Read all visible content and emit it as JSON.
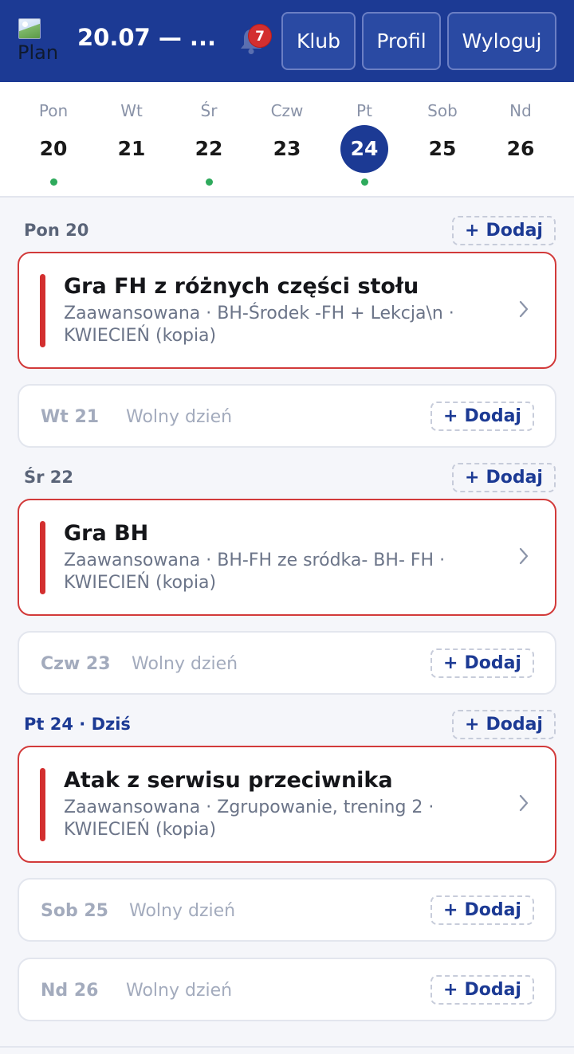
{
  "header": {
    "logo_alt": "Plan",
    "week_title": "20.07 — ...",
    "notification_count": "7",
    "buttons": {
      "club": "Klub",
      "profile": "Profil",
      "logout": "Wyloguj"
    }
  },
  "week": [
    {
      "name": "Pon",
      "date": "20",
      "has_training": true,
      "active": false
    },
    {
      "name": "Wt",
      "date": "21",
      "has_training": false,
      "active": false
    },
    {
      "name": "Śr",
      "date": "22",
      "has_training": true,
      "active": false
    },
    {
      "name": "Czw",
      "date": "23",
      "has_training": false,
      "active": false
    },
    {
      "name": "Pt",
      "date": "24",
      "has_training": true,
      "active": true
    },
    {
      "name": "Sob",
      "date": "25",
      "has_training": false,
      "active": false
    },
    {
      "name": "Nd",
      "date": "26",
      "has_training": false,
      "active": false
    }
  ],
  "add_label": "Dodaj",
  "add_plus": "+",
  "days": {
    "mon": {
      "label": "Pon 20",
      "training": {
        "title": "Gra FH z różnych części stołu",
        "meta": "Zaawansowana ·  BH-Środek -FH + Lekcja\\n   · KWIECIEŃ (kopia)"
      }
    },
    "tue": {
      "label": "Wt 21",
      "status": "Wolny dzień"
    },
    "wed": {
      "label": "Śr 22",
      "training": {
        "title": "Gra BH",
        "meta": "Zaawansowana ·  BH-FH ze sródka- BH- FH · KWIECIEŃ (kopia)"
      }
    },
    "thu": {
      "label": "Czw 23",
      "status": "Wolny dzień"
    },
    "fri": {
      "label": "Pt 24 · Dziś",
      "training": {
        "title": "Atak z serwisu przeciwnika",
        "meta": "Zaawansowana · Zgrupowanie, trening 2 · KWIECIEŃ (kopia)"
      }
    },
    "sat": {
      "label": "Sob 25",
      "status": "Wolny dzień"
    },
    "sun": {
      "label": "Nd 26",
      "status": "Wolny dzień"
    }
  },
  "colors": {
    "primary": "#1c3a94",
    "training_accent": "#d32f2f",
    "dot": "#2eaa5c",
    "badge": "#d32f2f"
  }
}
